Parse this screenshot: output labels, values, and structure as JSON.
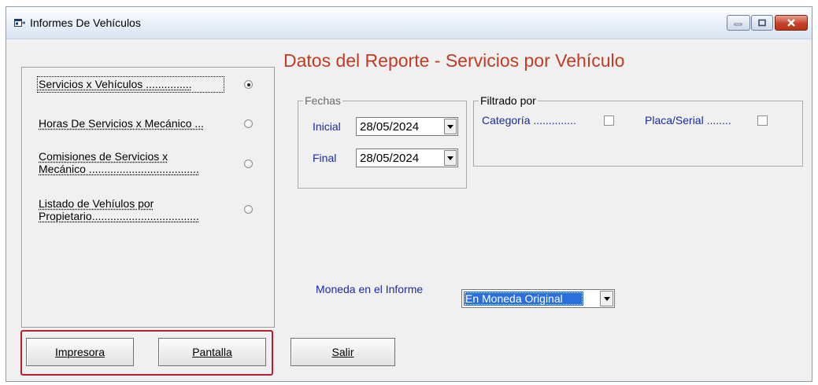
{
  "window": {
    "title": "Informes De Vehículos"
  },
  "report_options": [
    {
      "label": "Servicios x Vehículos ...............",
      "selected": true
    },
    {
      "label": "Horas De Servicios x Mecánico ...",
      "selected": false
    },
    {
      "label": "Comisiones de Servicios x Mecánico ....................................",
      "selected": false
    },
    {
      "label": "Listado de Vehíulos por Propietario...................................",
      "selected": false
    }
  ],
  "main": {
    "heading": "Datos del Reporte - Servicios por Vehículo",
    "fechas": {
      "group_label": "Fechas",
      "inicial_label": "Inicial",
      "inicial_value": "28/05/2024",
      "final_label": "Final",
      "final_value": "28/05/2024"
    },
    "filtrado": {
      "group_label": "Filtrado por",
      "categoria_label": "Categoría ..............",
      "categoria_checked": false,
      "placa_label": "Placa/Serial ........",
      "placa_checked": false
    },
    "moneda": {
      "label": "Moneda en el Informe",
      "value": "En Moneda Original"
    }
  },
  "buttons": {
    "impresora": "Impresora",
    "pantalla": "Pantalla",
    "salir": "Salir"
  },
  "colors": {
    "heading": "#c23b22",
    "label_blue": "#1a2aa8",
    "highlight_box": "#b5222e",
    "selection": "#2a6fdb"
  }
}
